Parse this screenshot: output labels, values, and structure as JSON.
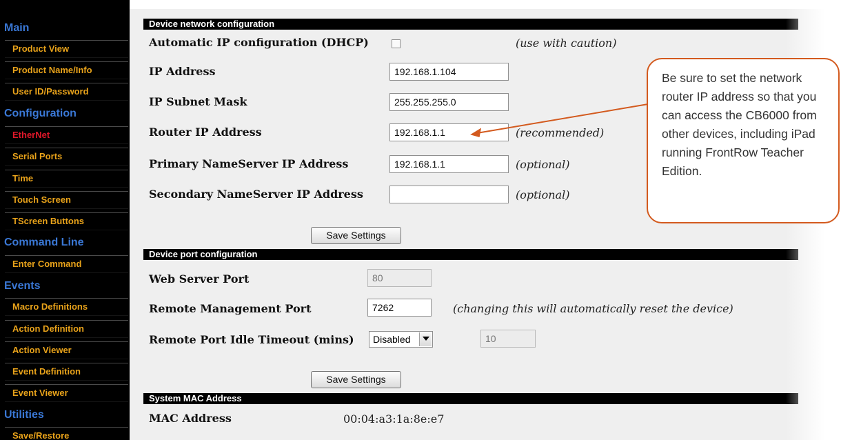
{
  "sidebar": {
    "sections": [
      {
        "label": "Main",
        "items": [
          "Product View",
          "Product Name/Info",
          "User ID/Password"
        ]
      },
      {
        "label": "Configuration",
        "items": [
          "EtherNet",
          "Serial Ports",
          "Time",
          "Touch Screen",
          "TScreen Buttons"
        ]
      },
      {
        "label": "Command Line",
        "items": [
          "Enter Command"
        ]
      },
      {
        "label": "Events",
        "items": [
          "Macro Definitions",
          "Action Definition",
          "Action Viewer",
          "Event Definition",
          "Event Viewer"
        ]
      },
      {
        "label": "Utilities",
        "items": [
          "Save/Restore"
        ]
      }
    ],
    "active_item": "EtherNet",
    "colors": {
      "section": "#3a78d6",
      "item": "#e8a21a",
      "active": "#e0182a"
    }
  },
  "network": {
    "header": "Device network configuration",
    "dhcp_label": "Automatic IP configuration (DHCP)",
    "dhcp_checked": false,
    "dhcp_note": "(use with caution)",
    "ip_label": "IP Address",
    "ip_value": "192.168.1.104",
    "mask_label": "IP Subnet Mask",
    "mask_value": "255.255.255.0",
    "router_label": "Router IP Address",
    "router_value": "192.168.1.1",
    "router_note": "(recommended)",
    "dns1_label": "Primary NameServer IP Address",
    "dns1_value": "192.168.1.1",
    "dns1_note": "(optional)",
    "dns2_label": "Secondary NameServer IP Address",
    "dns2_value": "",
    "dns2_note": "(optional)",
    "save_label": "Save Settings"
  },
  "ports": {
    "header": "Device port configuration",
    "web_label": "Web Server Port",
    "web_value": "80",
    "remote_label": "Remote Management Port",
    "remote_value": "7262",
    "remote_note": "(changing this will automatically reset the device)",
    "idle_label": "Remote Port Idle Timeout (mins)",
    "idle_select": "Disabled",
    "idle_value": "10",
    "save_label": "Save Settings"
  },
  "mac": {
    "header": "System MAC Address",
    "label": "MAC Address",
    "value": "00:04:a3:1a:8e:e7"
  },
  "callout": {
    "text": "Be sure to set the network router IP address so that you can access the CB6000 from other devices, including iPad running FrontRow Teacher Edition.",
    "border_color": "#d35a1e"
  }
}
